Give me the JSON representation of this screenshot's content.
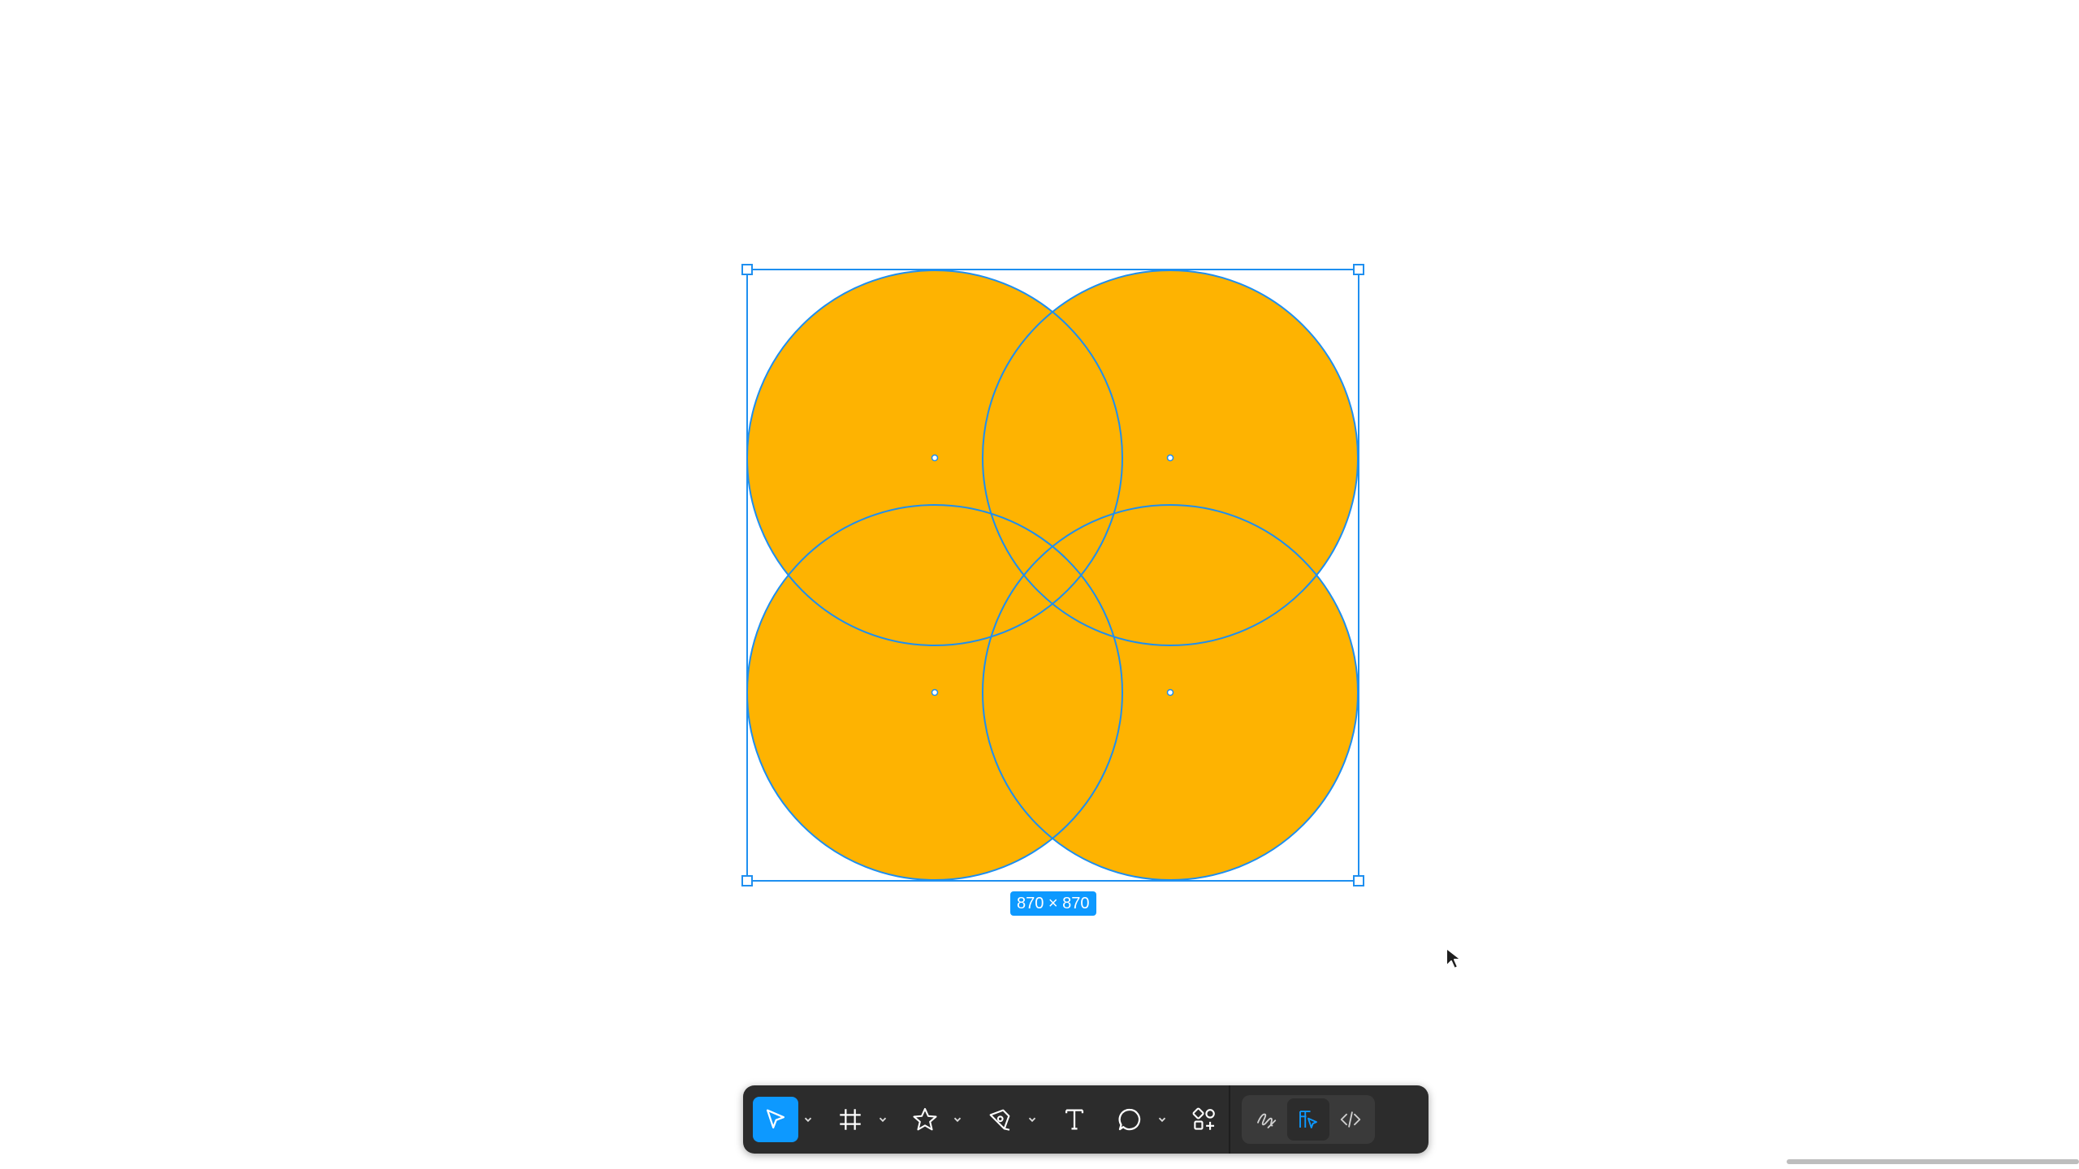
{
  "canvas": {
    "background": "#ffffff",
    "shape_fill": "#feb301",
    "selection_color": "#1e8ff0"
  },
  "selection": {
    "size_label": "870 × 870"
  },
  "cursor": {
    "icon": "arrow-cursor-icon"
  },
  "toolbar": {
    "tools": [
      {
        "icon": "move-arrow-icon",
        "active": true,
        "has_dropdown": true
      },
      {
        "icon": "frame-hash-icon",
        "active": false,
        "has_dropdown": true
      },
      {
        "icon": "star-icon",
        "active": false,
        "has_dropdown": true
      },
      {
        "icon": "pen-icon",
        "active": false,
        "has_dropdown": true
      },
      {
        "icon": "text-icon",
        "active": false,
        "has_dropdown": false
      },
      {
        "icon": "comment-bubble-icon",
        "active": false,
        "has_dropdown": true
      },
      {
        "icon": "actions-icon",
        "active": false,
        "has_dropdown": false
      }
    ],
    "modes": [
      {
        "icon": "draw-mode-icon",
        "active": false
      },
      {
        "icon": "design-mode-icon",
        "active": true
      },
      {
        "icon": "dev-mode-icon",
        "active": false
      }
    ],
    "accent": "#0d99ff"
  }
}
